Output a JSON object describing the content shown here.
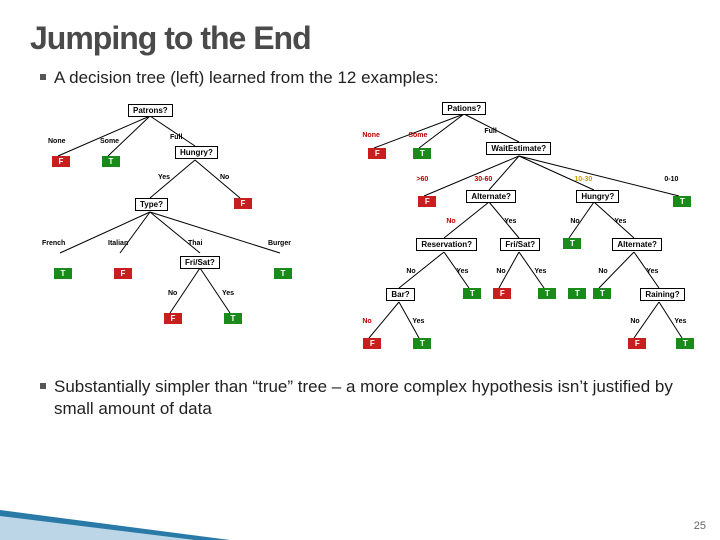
{
  "title": "Jumping to the End",
  "bullet1": "A decision tree (left) learned from the 12 examples:",
  "bullet2": "Substantially simpler than “true” tree – a more complex hypothesis isn’t justified by small amount of data",
  "page_number": "25",
  "left_tree": {
    "root": "Patrons?",
    "root_edges": [
      "None",
      "Some",
      "Full"
    ],
    "none_leaf": "F",
    "some_leaf": "T",
    "full_node": "Hungry?",
    "hungry_edges": [
      "Yes",
      "No"
    ],
    "hungry_no_leaf": "F",
    "type_node": "Type?",
    "type_edges": [
      "French",
      "Italian",
      "Thai",
      "Burger"
    ],
    "french_leaf": "T",
    "italian_leaf": "F",
    "burger_leaf": "T",
    "frisat_node": "Fri/Sat?",
    "frisat_edges": [
      "No",
      "Yes"
    ],
    "frisat_no_leaf": "F",
    "frisat_yes_leaf": "T"
  },
  "right_tree": {
    "root": "Pations?",
    "root_edges": [
      "None",
      "Some",
      "Full"
    ],
    "none_leaf": "F",
    "some_leaf": "T",
    "wait_node": "WaitEstimate?",
    "wait_edges": [
      ">60",
      "30-60",
      "10-30",
      "0-10"
    ],
    "gt60_leaf": "F",
    "e0_10_leaf": "T",
    "alt1_node": "Alternate?",
    "alt1_edges": [
      "No",
      "Yes"
    ],
    "hungry_node": "Hungry?",
    "hungry_edges": [
      "No",
      "Yes"
    ],
    "hungry_no_leaf": "T",
    "res_node": "Reservation?",
    "res_edges": [
      "No",
      "Yes"
    ],
    "res_yes_leaf": "T",
    "frisat_node": "Fri/Sat?",
    "frisat_edges": [
      "No",
      "Yes"
    ],
    "frisat_no_leaf": "F",
    "frisat_yes_leaf": "T",
    "bar_node": "Bar?",
    "bar_edges": [
      "No",
      "Yes"
    ],
    "bar_no_leaf": "F",
    "bar_yes_leaf": "T",
    "alt2_node": "Alternate?",
    "alt2_edges": [
      "No",
      "Yes"
    ],
    "alt2_no_leaf": "T",
    "rain_node": "Raining?",
    "rain_edges": [
      "No",
      "Yes"
    ],
    "rain_no_leaf": "F",
    "rain_yes_leaf": "T",
    "extra_t": "T"
  }
}
